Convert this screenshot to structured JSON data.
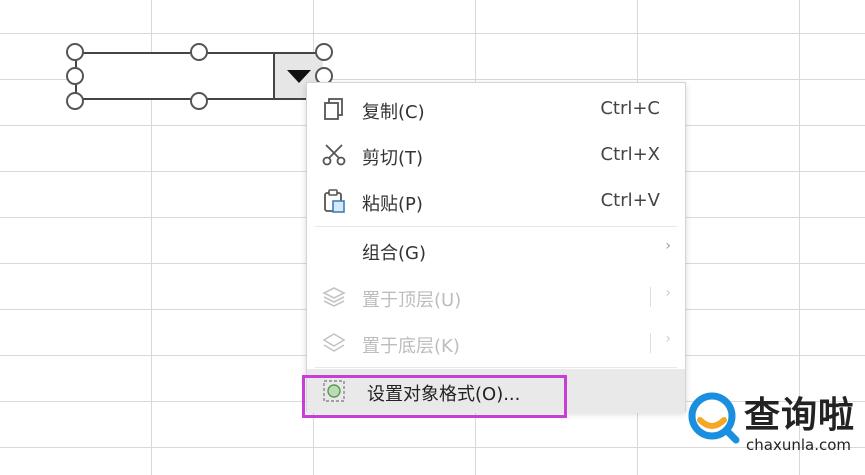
{
  "menu": {
    "items": [
      {
        "label": "复制(C)",
        "shortcut": "Ctrl+C",
        "icon": "copy-icon",
        "enabled": true
      },
      {
        "label": "剪切(T)",
        "shortcut": "Ctrl+X",
        "icon": "scissors-icon",
        "enabled": true
      },
      {
        "label": "粘贴(P)",
        "shortcut": "Ctrl+V",
        "icon": "paste-icon",
        "enabled": true
      },
      {
        "label": "组合(G)",
        "submenu": "›",
        "enabled": true
      },
      {
        "label": "置于顶层(U)",
        "submenu": "›",
        "icon": "bring-to-front-icon",
        "enabled": false
      },
      {
        "label": "置于底层(K)",
        "submenu": "›",
        "icon": "send-to-back-icon",
        "enabled": false
      },
      {
        "label": "设置对象格式(O)...",
        "icon": "format-object-icon",
        "enabled": true,
        "hovered": true
      }
    ]
  },
  "highlight_color": "#c83fd6",
  "watermark": {
    "brand": "查询啦",
    "domain": "chaxunla.com",
    "accent": "#1a8fe0",
    "highlight": "#f5a623"
  }
}
